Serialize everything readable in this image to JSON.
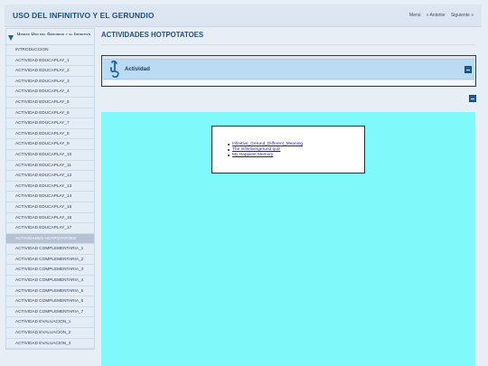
{
  "header": {
    "site_title": "USO DEL INFINITIVO Y EL GERUNDIO",
    "nav": {
      "menu": "Menú",
      "previous": "« Anterior",
      "next": "Siguiente »"
    }
  },
  "sidebar": {
    "section_title": "Unidad Uso del Gerundio y el Infinitivo",
    "active_index": 18,
    "items": [
      {
        "label": "INTRODUCCION"
      },
      {
        "label": "ACTIVIDAD EDUCAPLAY_1"
      },
      {
        "label": "ACTIVIDAD EDUCAPLAY_2"
      },
      {
        "label": "ACTIVIDAD EDUCAPLAY_3"
      },
      {
        "label": "ACTIVIDAD EDUCAPLAY_4"
      },
      {
        "label": "ACTIVIDAD EDUCAPLAY_5"
      },
      {
        "label": "ACTIVIDAD EDUCAPLAY_6"
      },
      {
        "label": "ACTIVIDAD EDUCAPLAY_7"
      },
      {
        "label": "ACTIVIDAD EDUCAPLAY_8"
      },
      {
        "label": "ACTIVIDAD EDUCAPLAY_9"
      },
      {
        "label": "ACTIVIDAD EDUCAPLAY_10"
      },
      {
        "label": "ACTIVIDAD EDUCAPLAY_11"
      },
      {
        "label": "ACTIVIDAD EDUCAPLAY_12"
      },
      {
        "label": "ACTIVIDAD EDUCAPLAY_13"
      },
      {
        "label": "ACTIVIDAD EDUCAPLAY_14"
      },
      {
        "label": "ACTIVIDAD EDUCAPLAY_15"
      },
      {
        "label": "ACTIVIDAD EDUCAPLAY_16"
      },
      {
        "label": "ACTIVIDAD EDUCAPLAY_17"
      },
      {
        "label": "ACTIVIDADES HOTPOTATOES"
      },
      {
        "label": "ACTIVIDAD COMPLEMENTARIA_1"
      },
      {
        "label": "ACTIVIDAD COMPLEMENTARIA_2"
      },
      {
        "label": "ACTIVIDAD COMPLEMENTARIA_3"
      },
      {
        "label": "ACTIVIDAD COMPLEMENTARIA_4"
      },
      {
        "label": "ACTIVIDAD COMPLEMENTARIA_5"
      },
      {
        "label": "ACTIVIDAD COMPLEMENTARIA_6"
      },
      {
        "label": "ACTIVIDAD COMPLEMENTARIA_7"
      },
      {
        "label": "ACTIVIDAD EVALUACION_1"
      },
      {
        "label": "ACTIVIDAD EVALUACION_2"
      },
      {
        "label": "ACTIVIDAD EVALUACION_3"
      }
    ]
  },
  "main": {
    "page_title": "ACTIVIDADES HOTPOTATOES",
    "idevice": {
      "label": "Actividad",
      "icon": "hook-icon"
    },
    "embedded_links": [
      "Infinitive_Gerund_Different_Meaning",
      "The infinitive/gerund quiz",
      "My Happiest Memory"
    ]
  },
  "colors": {
    "header_bg": "#dce6f2",
    "title_blue": "#1f4f80",
    "sidebar_active": "#b4c2d4",
    "idevice_bar": "#b9dcf4",
    "iframe_bg": "#7ff9fa",
    "link": "#1a1acc"
  }
}
